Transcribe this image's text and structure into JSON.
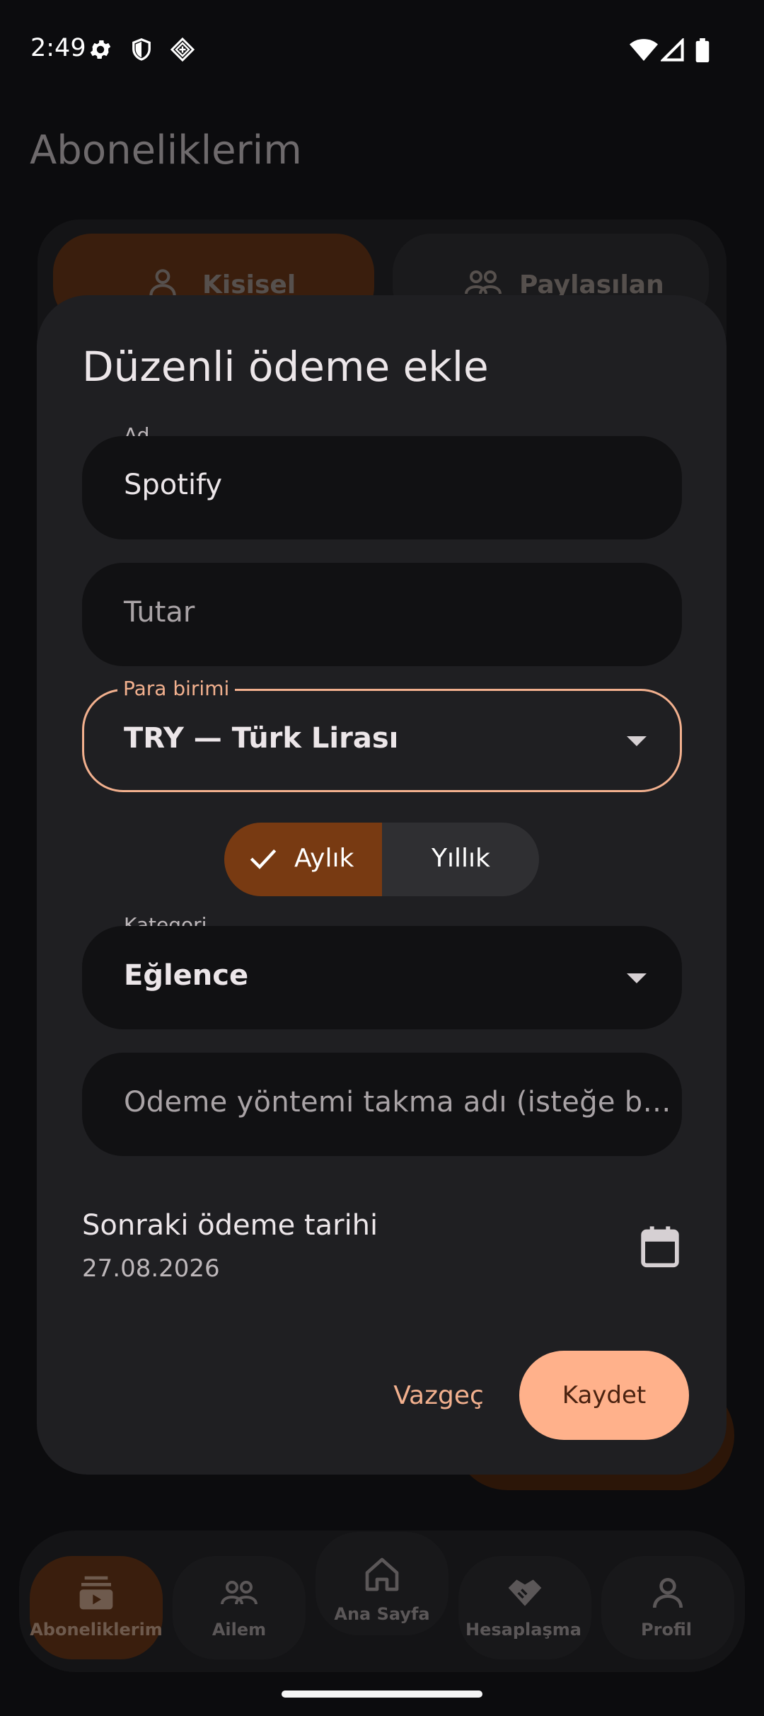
{
  "status_bar": {
    "time": "2:49"
  },
  "background": {
    "page_title": "Aboneliklerim",
    "segments": [
      "Kisisel",
      "Paylasılan"
    ]
  },
  "dialog": {
    "title": "Düzenli ödeme ekle",
    "name_field": {
      "label": "Ad",
      "value": "Spotify"
    },
    "amount_field": {
      "placeholder": "Tutar"
    },
    "currency_field": {
      "label": "Para birimi",
      "value": "TRY — Türk Lirası"
    },
    "period_toggle": {
      "selected": "Aylık",
      "other": "Yıllık"
    },
    "category_field": {
      "label": "Kategori",
      "value": "Eğlence"
    },
    "payment_method_field": {
      "placeholder": "Odeme yöntemi takma adı (isteğe b…"
    },
    "next_payment": {
      "label": "Sonraki ödeme tarihi",
      "value": "27.08.2026"
    },
    "cancel_label": "Vazgeç",
    "save_label": "Kaydet"
  },
  "bottom_nav": {
    "items": [
      {
        "label": "Aboneliklerim",
        "icon": "subscriptions-icon",
        "active": true
      },
      {
        "label": "Ailem",
        "icon": "group-icon",
        "active": false
      },
      {
        "label": "Ana Sayfa",
        "icon": "home-icon",
        "active": false
      },
      {
        "label": "Hesaplaşma",
        "icon": "handshake-icon",
        "active": false
      },
      {
        "label": "Profil",
        "icon": "person-icon",
        "active": false
      }
    ]
  },
  "colors": {
    "accent": "#ffb18b",
    "accent_outline": "#f2b08e",
    "toggle_selected": "#783a12",
    "dialog_bg": "#1f1f22",
    "field_bg": "#111113"
  }
}
